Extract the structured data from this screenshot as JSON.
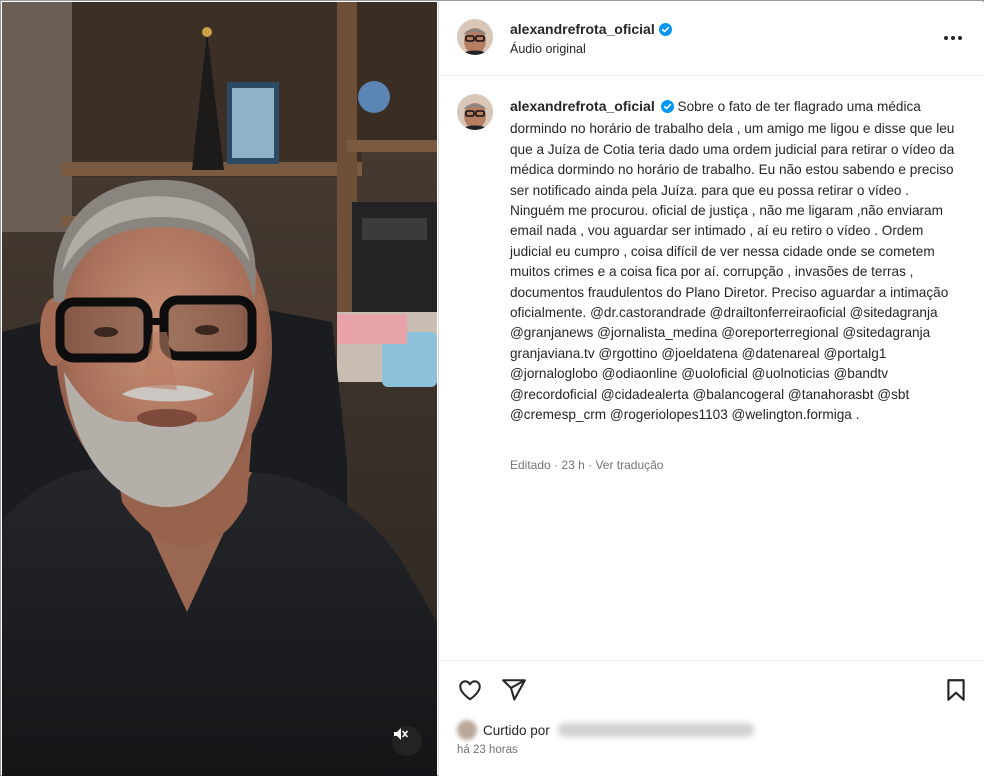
{
  "post": {
    "username": "alexandrefrota_oficial",
    "audio_label": "Áudio original",
    "more_icon": "more-horizontal-icon",
    "caption": "Sobre o fato de ter flagrado uma médica dormindo no horário de trabalho dela , um amigo me ligou e disse que leu que a Juíza de Cotia teria dado uma ordem judicial para retirar o vídeo da médica dormindo no horário de trabalho. Eu não estou sabendo e preciso ser notificado ainda pela Juíza. para que eu possa retirar o vídeo . Ninguém me procurou. oficial de justiça , não me ligaram ,não enviaram email nada , vou aguardar ser intimado , aí eu retiro o vídeo . Ordem judicial eu cumpro , coisa difícil de ver nessa cidade onde se cometem muitos crimes e a coisa fica por aí. corrupção , invasões de terras , documentos fraudulentos do Plano Diretor. Preciso aguardar a intimação oficialmente. @dr.castorandrade @drailtonferreiraoficial @sitedagranja @granjanews @jornalista_medina @oreporterregional @sitedagranja granjaviana.tv @rgottino @joeldatena @datenareal @portalg1 @jornaloglobo @odiaonline @uoloficial @uolnoticias @bandtv @recordoficial @cidadealerta @balancogeral @tanahorasbt @sbt @cremesp_crm @rogeriolopes1103 @welington.formiga .",
    "edited_label": "Editado",
    "time_short": "23 h",
    "translate_label": "Ver tradução",
    "liked_by_label": "Curtido por",
    "time_long": "há 23 horas"
  },
  "icons": {
    "verified": "verified-badge-icon",
    "like": "heart-icon",
    "share": "send-icon",
    "save": "bookmark-icon",
    "mute": "speaker-muted-icon"
  },
  "colors": {
    "verified_blue": "#0095f6",
    "text": "#262626",
    "muted_text": "#737373",
    "border": "#dbdbdb"
  }
}
